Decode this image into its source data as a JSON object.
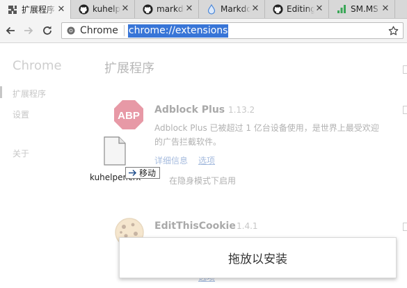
{
  "tabs": [
    {
      "title": "扩展程序",
      "icon": "puzzle-icon",
      "active": true
    },
    {
      "title": "kuhelper",
      "icon": "github-icon"
    },
    {
      "title": "markdown",
      "icon": "github-icon"
    },
    {
      "title": "Markdown",
      "icon": "drop-icon"
    },
    {
      "title": "Editing",
      "icon": "github-icon"
    },
    {
      "title": "SM.MS",
      "icon": "signal-bars-icon"
    }
  ],
  "toolbar": {
    "chip_label": "Chrome",
    "url": "chrome://extensions"
  },
  "sidebar": {
    "title": "Chrome",
    "items": [
      "扩展程序",
      "设置",
      "关于"
    ]
  },
  "main": {
    "title": "扩展程序",
    "extensions": [
      {
        "name": "Adblock Plus",
        "version": "1.13.2",
        "icon": "abp-icon",
        "icon_text": "ABP",
        "description_line1": "Adblock Plus 已被超过 1 亿台设备使用，是世界上最受欢迎",
        "description_line2": "的广告拦截软件。",
        "details_link": "详细信息",
        "options_link": "选项",
        "incognito_label": "在隐身模式下启用"
      },
      {
        "name": "EditThisCookie",
        "version": "1.4.1",
        "icon": "cookie-icon",
        "options_link": "选项"
      }
    ]
  },
  "drag": {
    "filename": "kuhelper.crx",
    "tooltip": "移动"
  },
  "drop_zone": {
    "label": "拖放以安装"
  },
  "colors": {
    "selection": "#3875d7",
    "abp_red": "#c70d2c",
    "link": "#2a5db0"
  }
}
